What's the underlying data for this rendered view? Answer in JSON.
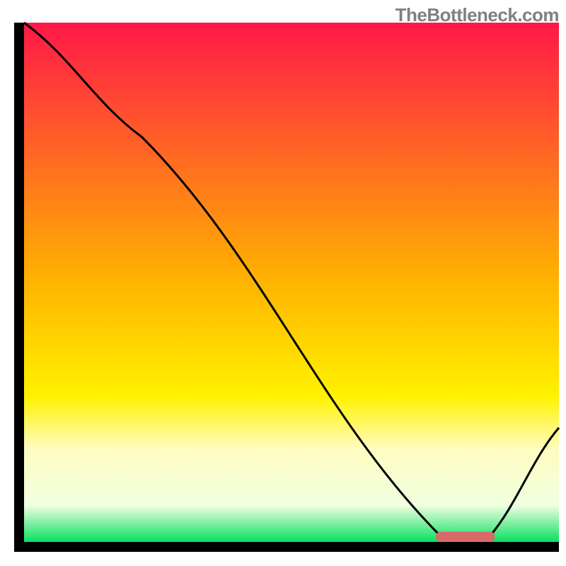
{
  "attribution": "TheBottleneck.com",
  "chart_data": {
    "type": "line",
    "title": "",
    "xlabel": "",
    "ylabel": "",
    "xlim": [
      0,
      100
    ],
    "ylim": [
      0,
      100
    ],
    "x": [
      0,
      22,
      78,
      87,
      100
    ],
    "values": [
      100,
      78,
      1,
      1,
      22
    ],
    "marker": {
      "x_range": [
        77,
        88
      ],
      "y": 1
    },
    "gradient_stops": [
      {
        "offset": 0,
        "color": "#ff1848"
      },
      {
        "offset": 50,
        "color": "#ffb400"
      },
      {
        "offset": 72,
        "color": "#fff200"
      },
      {
        "offset": 82,
        "color": "#fffcc0"
      },
      {
        "offset": 93,
        "color": "#f0ffe0"
      },
      {
        "offset": 100,
        "color": "#08e060"
      }
    ]
  }
}
